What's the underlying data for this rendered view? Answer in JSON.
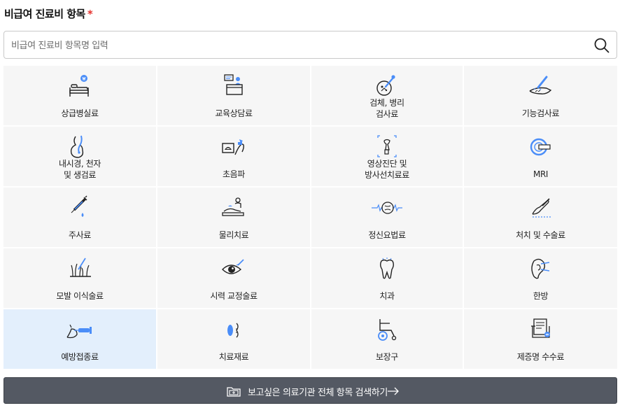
{
  "section": {
    "title": "비급여 진료비 항목",
    "required_mark": "*"
  },
  "search": {
    "placeholder": "비급여 진료비 항목명 입력",
    "value": "",
    "icon": "search-icon"
  },
  "categories": [
    {
      "label": "상급병실료",
      "icon": "hospital-bed-icon"
    },
    {
      "label": "교육상담료",
      "icon": "counseling-icon"
    },
    {
      "label": "검체, 병리\n검사료",
      "icon": "specimen-test-icon"
    },
    {
      "label": "기능검사료",
      "icon": "function-test-icon"
    },
    {
      "label": "내시경, 천자\n및 생검료",
      "icon": "endoscopy-icon"
    },
    {
      "label": "초음파",
      "icon": "ultrasound-icon"
    },
    {
      "label": "영상진단 및\n방사선치료료",
      "icon": "imaging-icon"
    },
    {
      "label": "MRI",
      "icon": "mri-icon"
    },
    {
      "label": "주사료",
      "icon": "syringe-icon"
    },
    {
      "label": "물리치료",
      "icon": "physical-therapy-icon"
    },
    {
      "label": "정신요법료",
      "icon": "brain-wave-icon"
    },
    {
      "label": "처치 및 수술료",
      "icon": "surgery-icon"
    },
    {
      "label": "모발 이식술료",
      "icon": "hair-transplant-icon"
    },
    {
      "label": "시력 교정술료",
      "icon": "eye-icon"
    },
    {
      "label": "치과",
      "icon": "tooth-icon"
    },
    {
      "label": "한방",
      "icon": "acupuncture-ear-icon"
    },
    {
      "label": "예방접종료",
      "icon": "vaccination-icon",
      "selected": true
    },
    {
      "label": "치료재료",
      "icon": "lens-material-icon"
    },
    {
      "label": "보장구",
      "icon": "wheelchair-icon"
    },
    {
      "label": "제증명 수수료",
      "icon": "certificate-icon"
    }
  ],
  "footer_button": {
    "label": "보고싶은 의료기관 전체 항목 검색하기",
    "icon": "hospital-folder-icon",
    "arrow_icon": "arrow-right-icon"
  },
  "colors": {
    "accent": "#4a8df8",
    "selected_bg": "#e3effc",
    "cell_bg": "#f6f6f6",
    "button_bg": "#545963",
    "required": "#e5322d"
  }
}
